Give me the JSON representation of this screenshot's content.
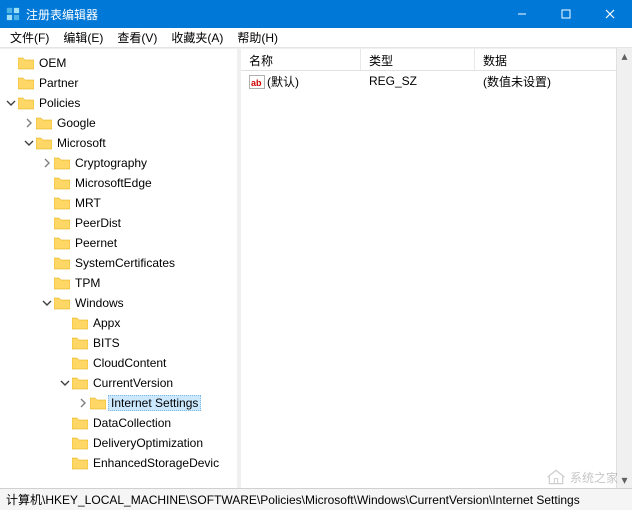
{
  "window": {
    "title": "注册表编辑器"
  },
  "menu": {
    "file": "文件(F)",
    "edit": "编辑(E)",
    "view": "查看(V)",
    "favorites": "收藏夹(A)",
    "help": "帮助(H)"
  },
  "tree": {
    "items": [
      {
        "label": "OEM",
        "depth": 0,
        "expandable": false
      },
      {
        "label": "Partner",
        "depth": 0,
        "expandable": false
      },
      {
        "label": "Policies",
        "depth": 0,
        "expandable": true,
        "expanded": true
      },
      {
        "label": "Google",
        "depth": 1,
        "expandable": true,
        "expanded": false
      },
      {
        "label": "Microsoft",
        "depth": 1,
        "expandable": true,
        "expanded": true
      },
      {
        "label": "Cryptography",
        "depth": 2,
        "expandable": true,
        "expanded": false
      },
      {
        "label": "MicrosoftEdge",
        "depth": 2,
        "expandable": false
      },
      {
        "label": "MRT",
        "depth": 2,
        "expandable": false
      },
      {
        "label": "PeerDist",
        "depth": 2,
        "expandable": false
      },
      {
        "label": "Peernet",
        "depth": 2,
        "expandable": false
      },
      {
        "label": "SystemCertificates",
        "depth": 2,
        "expandable": false
      },
      {
        "label": "TPM",
        "depth": 2,
        "expandable": false
      },
      {
        "label": "Windows",
        "depth": 2,
        "expandable": true,
        "expanded": true
      },
      {
        "label": "Appx",
        "depth": 3,
        "expandable": false
      },
      {
        "label": "BITS",
        "depth": 3,
        "expandable": false
      },
      {
        "label": "CloudContent",
        "depth": 3,
        "expandable": false
      },
      {
        "label": "CurrentVersion",
        "depth": 3,
        "expandable": true,
        "expanded": true
      },
      {
        "label": "Internet Settings",
        "depth": 4,
        "expandable": true,
        "expanded": false,
        "selected": true
      },
      {
        "label": "DataCollection",
        "depth": 3,
        "expandable": false
      },
      {
        "label": "DeliveryOptimization",
        "depth": 3,
        "expandable": false
      },
      {
        "label": "EnhancedStorageDevic",
        "depth": 3,
        "expandable": false
      }
    ]
  },
  "list": {
    "headers": {
      "name": "名称",
      "type": "类型",
      "data": "数据"
    },
    "rows": [
      {
        "name": "(默认)",
        "type": "REG_SZ",
        "data": "(数值未设置)"
      }
    ]
  },
  "statusbar": {
    "path": "计算机\\HKEY_LOCAL_MACHINE\\SOFTWARE\\Policies\\Microsoft\\Windows\\CurrentVersion\\Internet Settings"
  },
  "watermark": {
    "text": "系统之家"
  }
}
